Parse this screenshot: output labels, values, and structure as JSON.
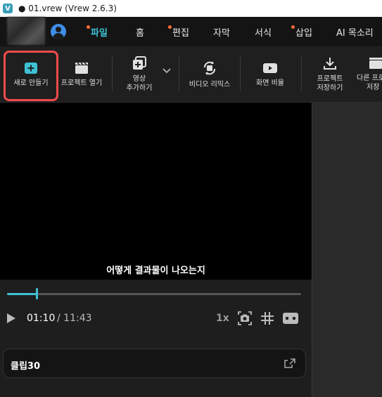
{
  "window": {
    "title": "● 01.vrew (Vrew 2.6.3)",
    "app_icon_glyph": "V"
  },
  "menu": {
    "items": [
      {
        "label": "파일",
        "active": true,
        "dot": true
      },
      {
        "label": "홈",
        "active": false,
        "dot": false
      },
      {
        "label": "편집",
        "active": false,
        "dot": true
      },
      {
        "label": "자막",
        "active": false,
        "dot": false
      },
      {
        "label": "서식",
        "active": false,
        "dot": false
      },
      {
        "label": "삽입",
        "active": false,
        "dot": true
      },
      {
        "label": "AI 목소리",
        "active": false,
        "dot": false
      }
    ]
  },
  "toolbar": {
    "new": "새로 만들기",
    "open_project": "프로젝트 열기",
    "add_video_1": "영상",
    "add_video_2": "추가하기",
    "video_remix": "비디오 리믹스",
    "aspect_ratio": "화면 비율",
    "save_project_1": "프로젝트",
    "save_project_2": "저장하기",
    "save_other_1": "다른 프로",
    "save_other_2": "저장"
  },
  "video": {
    "subtitle": "어떻게 결과물이 나오는지"
  },
  "player": {
    "current_time": "01:10",
    "total_time": "/ 11:43",
    "speed": "1x",
    "progress_fraction": 0.1
  },
  "clip": {
    "label": "클립30"
  },
  "colors": {
    "accent": "#3ec1d3",
    "highlight": "#f24b4b",
    "menu_dot": "#ff6b35"
  }
}
